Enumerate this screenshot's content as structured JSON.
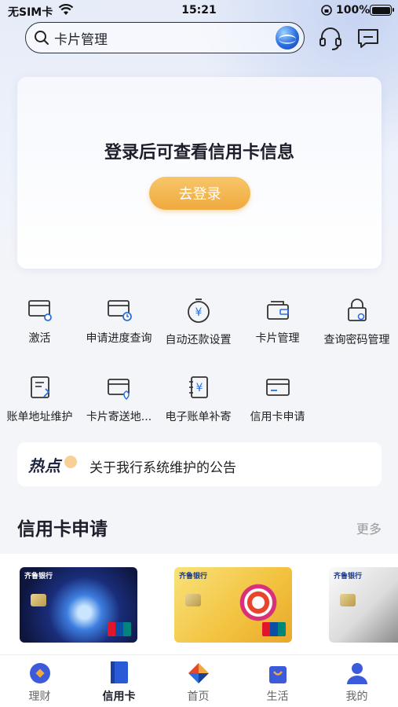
{
  "status_bar": {
    "carrier": "无SIM卡",
    "time": "15:21",
    "battery": "100%"
  },
  "search": {
    "value": "卡片管理"
  },
  "login_card": {
    "title": "登录后可查看信用卡信息",
    "button": "去登录"
  },
  "quick_actions": [
    {
      "label": "激活",
      "icon": "card-activate-icon"
    },
    {
      "label": "申请进度查询",
      "icon": "card-progress-icon"
    },
    {
      "label": "自动还款设置",
      "icon": "auto-repay-icon"
    },
    {
      "label": "卡片管理",
      "icon": "wallet-icon"
    },
    {
      "label": "查询密码管理",
      "icon": "lock-icon"
    },
    {
      "label": "账单地址维护",
      "icon": "bill-address-icon"
    },
    {
      "label": "卡片寄送地...",
      "icon": "card-delivery-icon"
    },
    {
      "label": "电子账单补寄",
      "icon": "e-bill-icon"
    },
    {
      "label": "信用卡申请",
      "icon": "card-apply-icon"
    }
  ],
  "hot_news": {
    "tag": "热点",
    "text": "关于我行系统维护的公告"
  },
  "section": {
    "title": "信用卡申请",
    "more": "更多"
  },
  "cards": [
    {
      "bank": "齐鲁银行"
    },
    {
      "bank": "齐鲁银行"
    },
    {
      "bank": "齐鲁银行"
    }
  ],
  "tabs": [
    {
      "label": "理财",
      "active": false
    },
    {
      "label": "信用卡",
      "active": true
    },
    {
      "label": "首页",
      "active": false
    },
    {
      "label": "生活",
      "active": false
    },
    {
      "label": "我的",
      "active": false
    }
  ],
  "colors": {
    "accent": "#f0a93e",
    "brand_blue": "#2a6fe0"
  }
}
